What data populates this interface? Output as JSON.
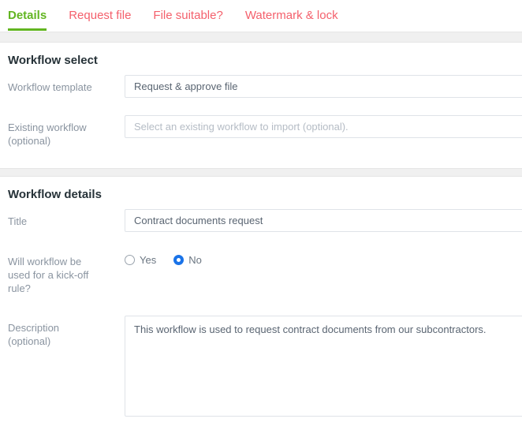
{
  "colors": {
    "active_tab": "#62b521",
    "inactive_tab": "#f4606c",
    "radio_selected": "#1a73e8",
    "band": "#f0f0f0",
    "input_border": "#dfe3e8"
  },
  "tabs": [
    {
      "label": "Details",
      "active": true
    },
    {
      "label": "Request file",
      "active": false
    },
    {
      "label": "File suitable?",
      "active": false
    },
    {
      "label": "Watermark & lock",
      "active": false
    }
  ],
  "workflow_select": {
    "heading": "Workflow select",
    "template": {
      "label": "Workflow template",
      "value": "Request & approve file",
      "placeholder": ""
    },
    "existing": {
      "label": "Existing workflow (optional)",
      "label_line1": "Existing workflow",
      "label_line2": "(optional)",
      "value": "",
      "placeholder": "Select an existing workflow to import (optional)."
    }
  },
  "workflow_details": {
    "heading": "Workflow details",
    "title": {
      "label": "Title",
      "value": "Contract documents request",
      "placeholder": ""
    },
    "kickoff": {
      "label_line1": "Will workflow be",
      "label_line2": "used for a kick-off",
      "label_line3": "rule?",
      "options": [
        {
          "label": "Yes",
          "selected": false
        },
        {
          "label": "No",
          "selected": true
        }
      ]
    },
    "description": {
      "label_line1": "Description",
      "label_line2": "(optional)",
      "value": "This workflow is used to request contract documents from our subcontractors.",
      "placeholder": ""
    }
  }
}
